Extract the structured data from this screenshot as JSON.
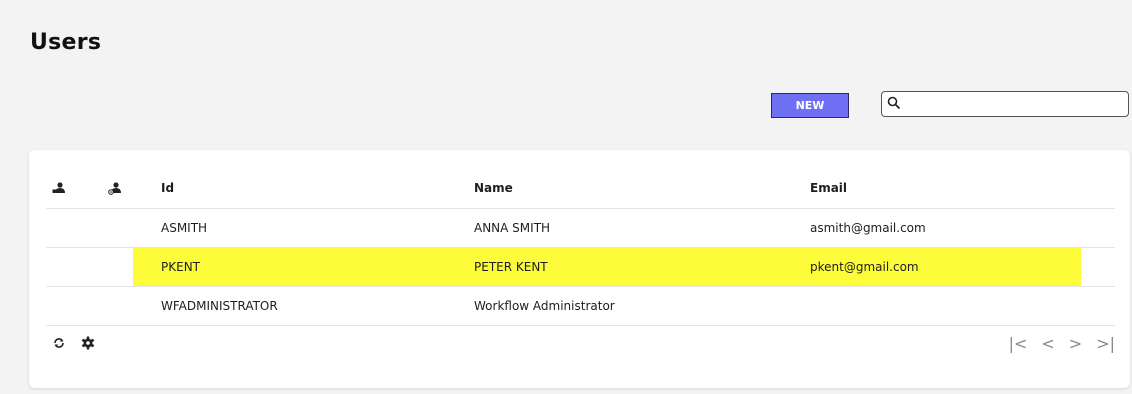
{
  "page": {
    "title": "Users"
  },
  "toolbar": {
    "new_label": "NEW",
    "search_placeholder": "",
    "search_value": ""
  },
  "table": {
    "columns": {
      "id": "Id",
      "name": "Name",
      "email": "Email"
    },
    "rows": [
      {
        "id": "ASMITH",
        "name": "ANNA SMITH",
        "email": "asmith@gmail.com",
        "highlighted": false
      },
      {
        "id": "PKENT",
        "name": "PETER KENT",
        "email": "pkent@gmail.com",
        "highlighted": true
      },
      {
        "id": "WFADMINISTRATOR",
        "name": "Workflow Administrator",
        "email": "",
        "highlighted": false
      }
    ]
  },
  "pager": {
    "first": "|<",
    "prev": "<",
    "next": ">",
    "last": ">|"
  },
  "colors": {
    "accent": "#6e6ff2",
    "highlight": "#fcfc3a"
  }
}
